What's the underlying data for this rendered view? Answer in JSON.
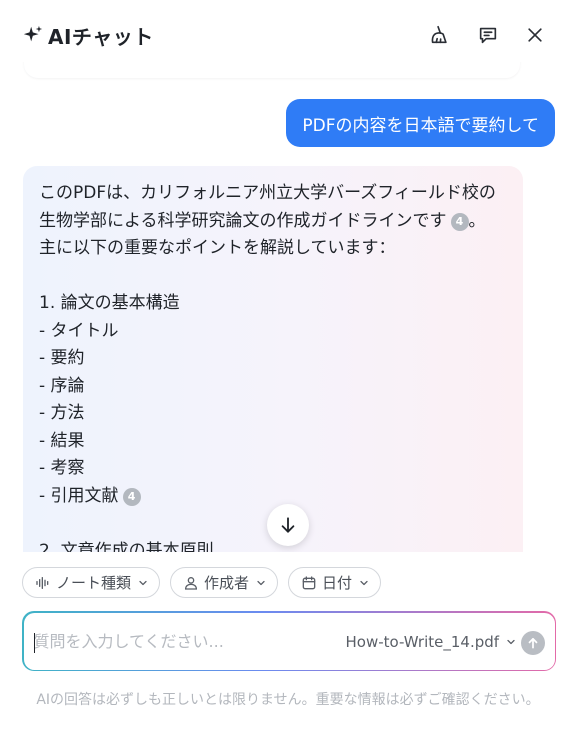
{
  "header": {
    "title": "AIチャット",
    "icons": [
      "sparkle-icon",
      "clean-brush-icon",
      "chat-history-icon",
      "close-icon"
    ]
  },
  "messages": {
    "user": "PDFの内容を日本語で要約して",
    "ai": {
      "l1": "このPDFは、カリフォルニア州立大学バーズフィールド校の",
      "l2": "生物学部による科学研究論文の作成ガイドラインです",
      "l2_cite": "4",
      "l2_end": "。",
      "l3": "主に以下の重要なポイントを解説しています：",
      "l4": "1. 論文の基本構造",
      "l5": "- タイトル",
      "l6": "- 要約",
      "l7": "- 序論",
      "l8": "- 方法",
      "l9": "- 結果",
      "l10": "- 考察",
      "l11": "- 引用文献",
      "l11_cite": "4",
      "l12": "2. 文章作成の基本原則"
    }
  },
  "filters": {
    "note_type": "ノート種類",
    "author": "作成者",
    "date": "日付"
  },
  "input": {
    "placeholder": "質問を入力してください...",
    "file": "How-to-Write_14.pdf"
  },
  "disclaimer": "AIの回答は必ずしも正しいとは限りません。重要な情報は必ずご確認ください。",
  "colors": {
    "user_bubble": "#2f7cf6",
    "citation_badge": "#b3b8bf",
    "send_disabled": "#b9bdc3"
  }
}
